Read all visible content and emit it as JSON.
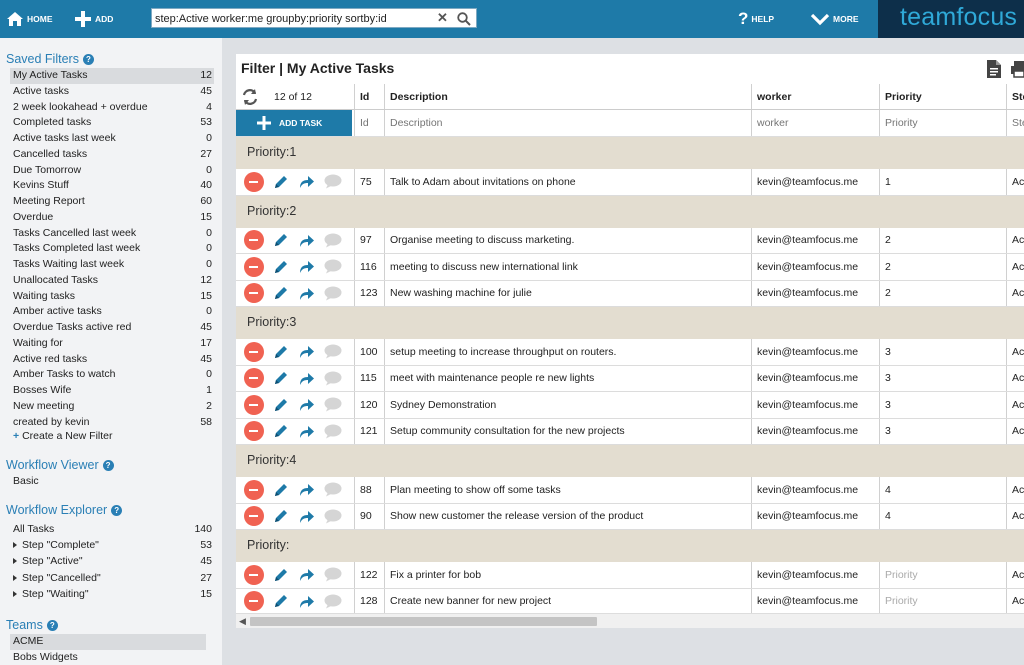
{
  "topbar": {
    "home_label": "HOME",
    "add_label": "ADD",
    "search_value": "step:Active worker:me groupby:priority sortby:id",
    "help_label": "HELP",
    "more_label": "MORE",
    "logo_text": "teamfocus"
  },
  "sidebar": {
    "saved_filters_title": "Saved Filters",
    "filters": [
      {
        "label": "My Active Tasks",
        "count": "12"
      },
      {
        "label": "Active tasks",
        "count": "45"
      },
      {
        "label": "2 week lookahead + overdue",
        "count": "4"
      },
      {
        "label": "Completed tasks",
        "count": "53"
      },
      {
        "label": "Active tasks last week",
        "count": "0"
      },
      {
        "label": "Cancelled tasks",
        "count": "27"
      },
      {
        "label": "Due Tomorrow",
        "count": "0"
      },
      {
        "label": "Kevins Stuff",
        "count": "40"
      },
      {
        "label": "Meeting Report",
        "count": "60"
      },
      {
        "label": "Overdue",
        "count": "15"
      },
      {
        "label": "Tasks Cancelled last week",
        "count": "0"
      },
      {
        "label": "Tasks Completed last week",
        "count": "0"
      },
      {
        "label": "Tasks Waiting last week",
        "count": "0"
      },
      {
        "label": "Unallocated Tasks",
        "count": "12"
      },
      {
        "label": "Waiting tasks",
        "count": "15"
      },
      {
        "label": "Amber active tasks",
        "count": "0"
      },
      {
        "label": "Overdue Tasks active red",
        "count": "45"
      },
      {
        "label": "Waiting for",
        "count": "17"
      },
      {
        "label": "Active red tasks",
        "count": "45"
      },
      {
        "label": "Amber Tasks to watch",
        "count": "0"
      },
      {
        "label": "Bosses Wife",
        "count": "1"
      },
      {
        "label": "New meeting",
        "count": "2"
      },
      {
        "label": "created by kevin",
        "count": "58"
      }
    ],
    "create_filter_label": "Create a New Filter",
    "workflow_viewer_title": "Workflow Viewer",
    "workflow_viewer_items": [
      "Basic"
    ],
    "workflow_explorer_title": "Workflow Explorer",
    "workflow_explorer_items": [
      {
        "label": "All Tasks",
        "count": "140"
      },
      {
        "label": "Step \"Complete\"",
        "count": "53"
      },
      {
        "label": "Step \"Active\"",
        "count": "45"
      },
      {
        "label": "Step \"Cancelled\"",
        "count": "27"
      },
      {
        "label": "Step \"Waiting\"",
        "count": "15"
      }
    ],
    "teams_title": "Teams",
    "teams": [
      "ACME",
      "Bobs Widgets"
    ]
  },
  "main": {
    "title": "Filter | My Active Tasks",
    "pager": "12 of 12",
    "add_task_label": "ADD TASK",
    "columns": {
      "id": "Id",
      "description": "Description",
      "worker": "worker",
      "priority": "Priority",
      "step": "Step"
    },
    "placeholders": {
      "id": "Id",
      "description": "Description",
      "worker": "worker",
      "priority": "Priority",
      "step": "Step"
    },
    "groups": [
      {
        "label": "Priority:1",
        "rows": [
          {
            "id": "75",
            "description": "Talk to Adam about invitations on phone",
            "worker": "kevin@teamfocus.me",
            "priority": "1",
            "step": "Active"
          }
        ]
      },
      {
        "label": "Priority:2",
        "rows": [
          {
            "id": "97",
            "description": "Organise meeting to discuss marketing.",
            "worker": "kevin@teamfocus.me",
            "priority": "2",
            "step": "Active"
          },
          {
            "id": "116",
            "description": "meeting to discuss new international link",
            "worker": "kevin@teamfocus.me",
            "priority": "2",
            "step": "Active"
          },
          {
            "id": "123",
            "description": "New washing machine for julie",
            "worker": "kevin@teamfocus.me",
            "priority": "2",
            "step": "Active"
          }
        ]
      },
      {
        "label": "Priority:3",
        "rows": [
          {
            "id": "100",
            "description": "setup meeting to increase throughput on routers.",
            "worker": "kevin@teamfocus.me",
            "priority": "3",
            "step": "Active"
          },
          {
            "id": "115",
            "description": "meet with maintenance people re new lights",
            "worker": "kevin@teamfocus.me",
            "priority": "3",
            "step": "Active"
          },
          {
            "id": "120",
            "description": "Sydney Demonstration",
            "worker": "kevin@teamfocus.me",
            "priority": "3",
            "step": "Active"
          },
          {
            "id": "121",
            "description": "Setup community consultation for the new projects",
            "worker": "kevin@teamfocus.me",
            "priority": "3",
            "step": "Active"
          }
        ]
      },
      {
        "label": "Priority:4",
        "rows": [
          {
            "id": "88",
            "description": "Plan meeting to show off some tasks",
            "worker": "kevin@teamfocus.me",
            "priority": "4",
            "step": "Active"
          },
          {
            "id": "90",
            "description": "Show new customer the release version of the product",
            "worker": "kevin@teamfocus.me",
            "priority": "4",
            "step": "Active"
          }
        ]
      },
      {
        "label": "Priority:",
        "rows": [
          {
            "id": "122",
            "description": "Fix a printer for bob",
            "worker": "kevin@teamfocus.me",
            "priority": "",
            "priority_placeholder": "Priority",
            "step": "Active"
          },
          {
            "id": "128",
            "description": "Create new banner for new project",
            "worker": "kevin@teamfocus.me",
            "priority": "",
            "priority_placeholder": "Priority",
            "step": "Active"
          }
        ]
      }
    ]
  },
  "colors": {
    "accent": "#1e7aa8",
    "group_band": "#e3ddd0",
    "stop": "#f06252",
    "logo_bg": "#0d2f4a"
  }
}
